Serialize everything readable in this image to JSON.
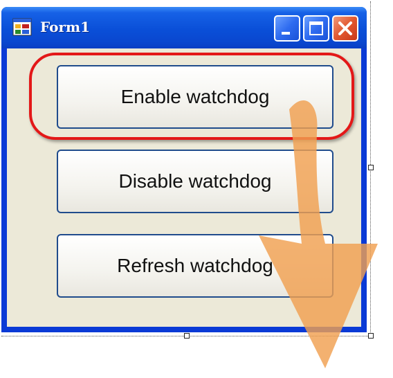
{
  "window": {
    "title": "Form1",
    "icon": "form-window-icon",
    "controls": [
      "minimize-icon",
      "maximize-icon",
      "close-icon"
    ]
  },
  "buttons": {
    "enable": "Enable watchdog",
    "disable": "Disable watchdog",
    "refresh": "Refresh watchdog"
  },
  "annotations": {
    "highlight_color": "#e31818",
    "arrow_color": "#f0a050"
  }
}
